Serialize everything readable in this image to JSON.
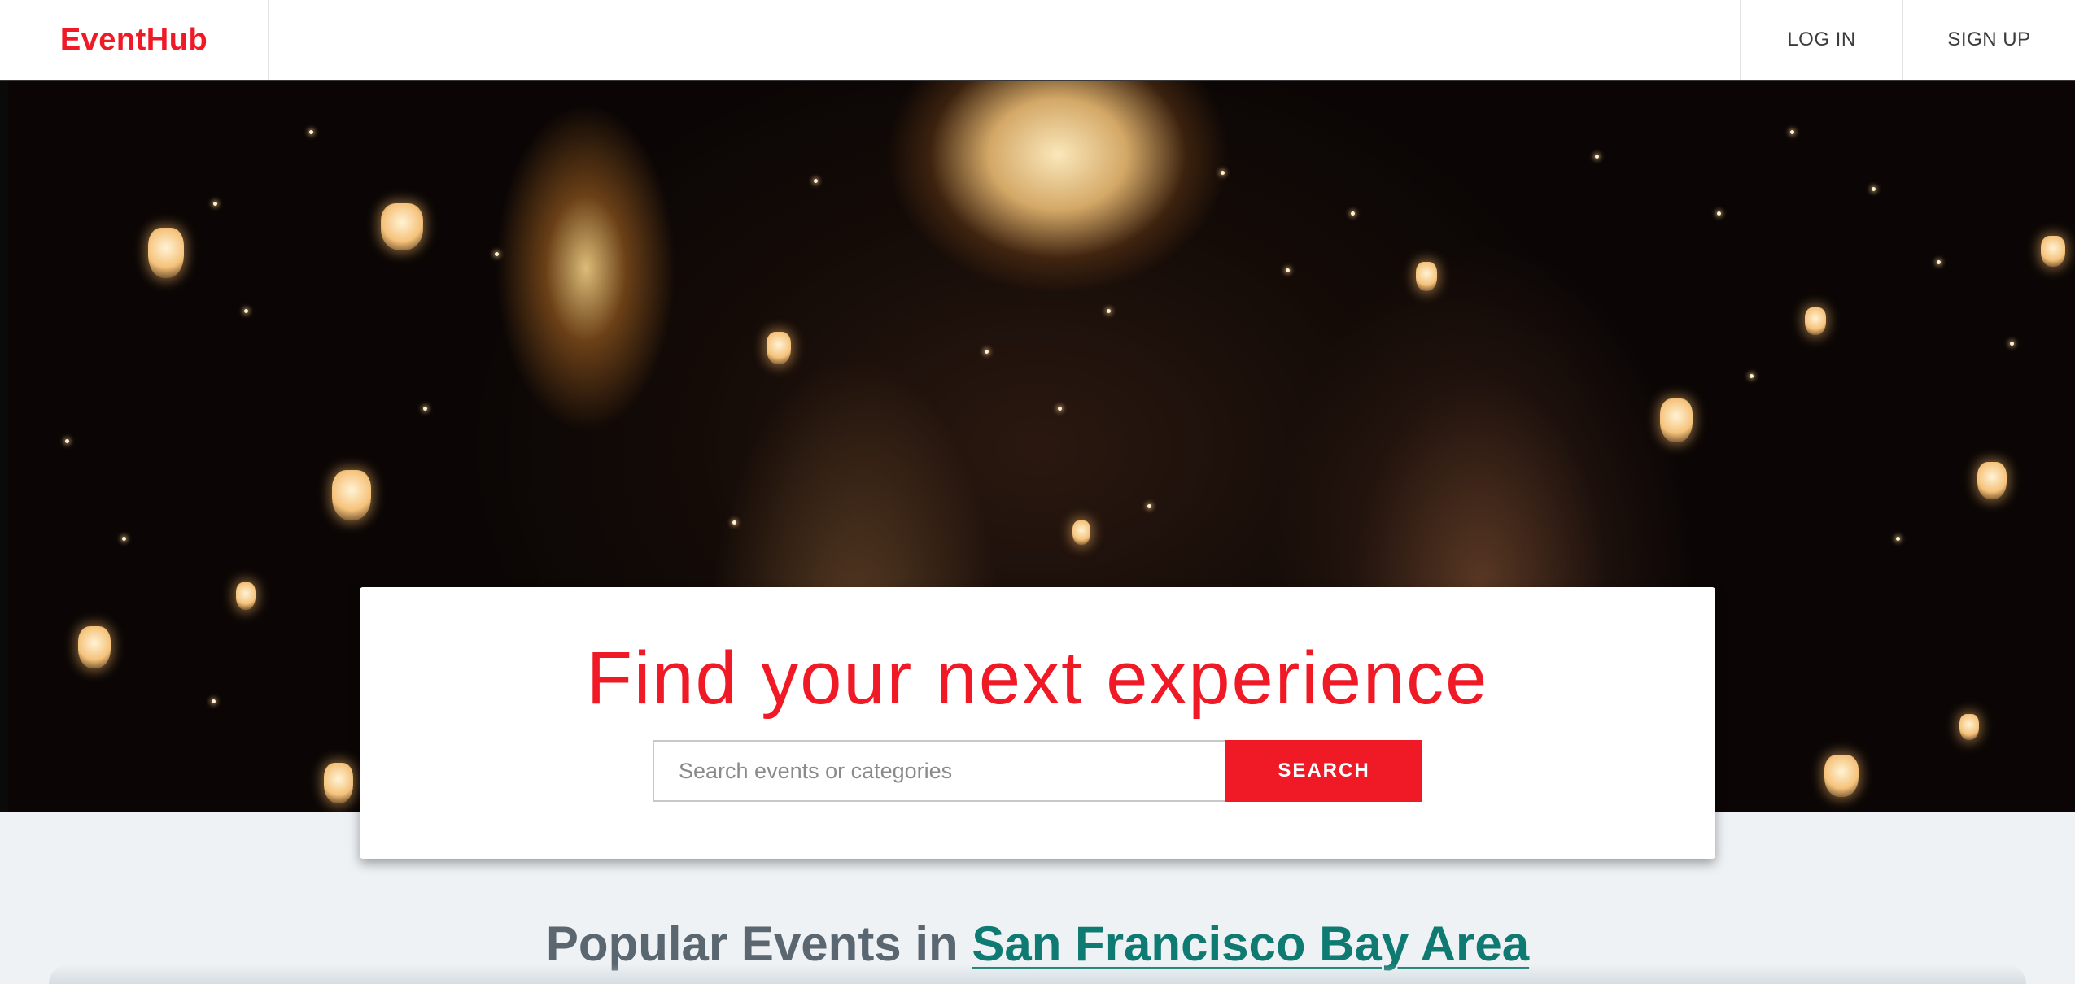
{
  "header": {
    "brand": "EventHub",
    "nav": {
      "login_label": "LOG IN",
      "signup_label": "SIGN UP"
    }
  },
  "hero": {
    "image": "night-sky-lanterns-photo"
  },
  "search": {
    "headline": "Find your next experience",
    "placeholder": "Search events or categories",
    "button_label": "SEARCH"
  },
  "popular": {
    "prefix": "Popular Events in",
    "location": "San Francisco Bay Area"
  },
  "colors": {
    "brand": "#f01a26",
    "link": "#0e7a72",
    "background": "#eef2f5"
  }
}
